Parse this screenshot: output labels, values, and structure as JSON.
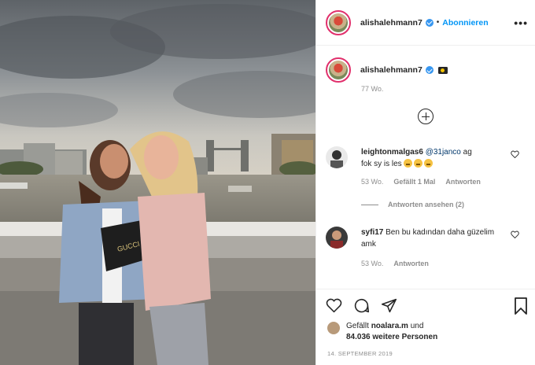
{
  "post": {
    "photo_alt": "Two women smiling on a bridge over the Thames with Tower Bridge in background",
    "photo_logo_text": "GUCCI"
  },
  "header": {
    "username": "alishalehmann7",
    "separator": "•",
    "follow_label": "Abonnieren",
    "more_label": "•••"
  },
  "caption": {
    "username": "alishalehmann7",
    "time": "77 Wo."
  },
  "comments": [
    {
      "username": "leightonmalgas6",
      "mention": "@31janco",
      "text_line1": "ag",
      "text_line2": "fok sy is les",
      "time": "53 Wo.",
      "likes": "Gefällt 1 Mal",
      "reply_label": "Antworten",
      "view_replies": "Antworten ansehen (2)"
    },
    {
      "username": "syfi17",
      "text": "Ben bu kadından daha güzelim amk",
      "time": "53 Wo.",
      "reply_label": "Antworten"
    }
  ],
  "footer": {
    "liked_by_prefix": "Gefällt",
    "liked_by_user": "noalara.m",
    "liked_by_and": "und",
    "others": "84.036 weitere Personen",
    "date": "14. SEPTEMBER 2019"
  }
}
